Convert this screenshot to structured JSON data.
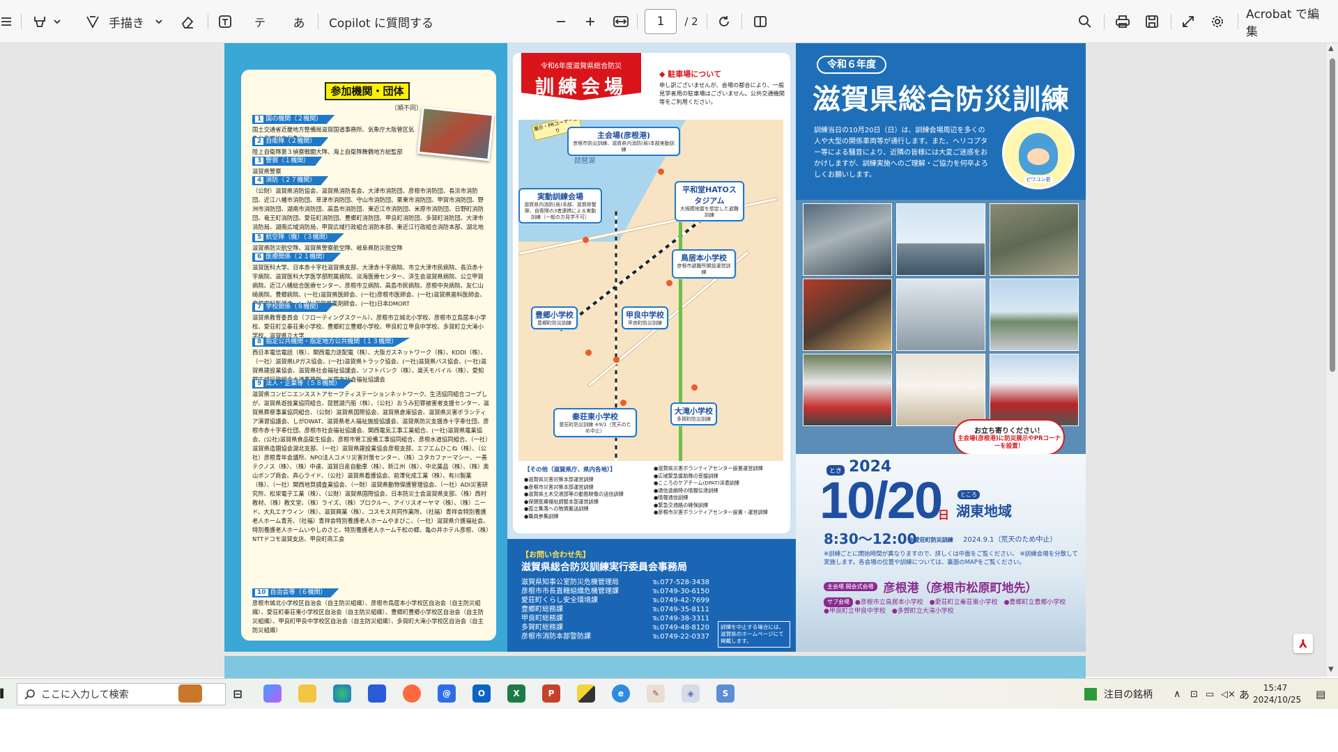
{
  "toolbar": {
    "handwrite_label": "手描き",
    "copilot_label": "Copilot に質問する",
    "current_page": "1",
    "page_total": "/ 2",
    "acrobat_label": "Acrobat で編集",
    "text_icon": "テ",
    "kana_icon": "あ"
  },
  "panel1": {
    "title": "参加機関・団体",
    "note": "（順不同）",
    "sections": [
      {
        "num": "1",
        "head": "国の機関",
        "count": "（２機関）",
        "text": "国土交通省近畿地方整備局滋賀国道事務所、気象庁大阪管区気象台彦根地方気象台"
      },
      {
        "num": "2",
        "head": "自衛隊",
        "count": "（２機関）",
        "text": "陸上自衛隊第３偵察戦闘大隊、海上自衛隊舞鶴地方総監部"
      },
      {
        "num": "3",
        "head": "警察",
        "count": "（１機関）",
        "text": "滋賀県警察"
      },
      {
        "num": "4",
        "head": "消防",
        "count": "（２７機関）",
        "text": "（公財）滋賀県消防協会、滋賀県消防長会、大津市消防団、彦根市消防団、長浜市消防団、近江八幡市消防団、草津市消防団、守山市消防団、栗東市消防団、甲賀市消防団、野洲市消防団、湖南市消防団、高島市消防団、東近江市消防団、米原市消防団、日野町消防団、竜王町消防団、愛荘町消防団、豊郷町消防団、甲良町消防団、多賀町消防団、大津市消防局、湖南広域消防局、甲賀広域行政組合消防本部、東近江行政組合消防本部、湖北地域消防本部、高島市消防本部"
      },
      {
        "num": "5",
        "head": "航空隊（機）",
        "count": "（３機関）",
        "text": "滋賀県防災航空隊、滋賀県警察航空隊、岐阜県防災航空隊"
      },
      {
        "num": "6",
        "head": "医療関係",
        "count": "（２１機関）",
        "text": "滋賀医科大学、日本赤十字社滋賀県支部、大津赤十字病院、市立大津市民病院、長浜赤十字病院、滋賀医科大学医学部附属病院、淡海医療センター、済生会滋賀県病院、公立甲賀病院、近江八幡総合医療センター、彦根市立病院、高島市民病院、彦根中央病院、友仁山崎病院、豊郷病院、(一社)滋賀県医師会、(一社)彦根市医師会、(一社)滋賀県歯科医師会、彦根歯科医師会、(一社)滋賀県薬剤師会、(一社)日本DMORT"
      },
      {
        "num": "7",
        "head": "学校関係",
        "count": "（８機関）",
        "text": "滋賀県教育委員会（フローティングスクール）、彦根市立城北小学校、彦根市立鳥居本小学校、愛荘町立秦荘東小学校、豊郷町立豊郷小学校、甲良町立甲良中学校、多賀町立大滝小学校、滋賀県立大学"
      },
      {
        "num": "8",
        "head": "指定公共機関・指定地方公共機関",
        "count": "（１３機関）",
        "text": "西日本電信電話（株）、関西電力送配電（株）、大阪ガスネットワーク（株）、KDDI（株）、（一社）滋賀県LPガス協会、(一社)滋賀県トラック協会、(一社)滋賀県バス協会、(一社)滋賀県建設業協会、滋賀県社会福祉協議会、ソフトバンク（株）、楽天モバイル（株）、愛知郡広域行政組合水道事務所、米原市社会福祉協議会"
      },
      {
        "num": "9",
        "head": "法人・企業等",
        "count": "（５８機関）",
        "text": "滋賀県コンビニエンスストアセーフティステーションネットワーク、生活協同組合コープしが、滋賀県遊技業協同組合、琵琶湖汽船（株）、（公社）おうみ犯罪被害者支援センター、滋賀県葬祭事業協同組合、（公財）滋賀県国際協会、滋賀県倉庫協会、滋賀県災害ボランティア演習協議会、しがDWAT、滋賀県老人福祉施設協議会、滋賀県防災支援赤十字奉仕団、彦根市赤十字奉仕団、彦根市社会福祉協議会、関西電気工事工業組合、(一社)滋賀県電業協会、(公社)滋賀県食品衛生協会、彦根市管工設備工事協同組合、彦根水道協同組合、（一社）滋賀県造園協会湖北支部、（一社）滋賀県建設業協会彦根支部、エフエムひこね（株）、（公社）彦根青年会議所、NPO法人コメリ災害対策センター、（株）ユタカファーマシー、一善テクノス（株）、（株）中達、滋賀日産自動車（株）、新江州（株）、中北薬品（株）、（株）奥山ボンプ商会、真心ライド、（公社）滋賀県看護協会、前澤化成工業（株）、有川製薬（株）、（一社）関西地質調査業協会、（一財）滋賀県動物保護管理協会、（一社）ADI災害研究所、松栄電子工業（株）、（公財）滋賀県国際協会、日本防災士会滋賀県支部、（株）西村教材、（株）教文堂、（株）ライズ、（株）プロクルー、アイリスオーヤマ（株）、（株）ニード、大丸エナウィン（株）、滋賀興業（株）、コスモス共同作業所、（社福）青祥会特別養護老人ホーム青芳、（社福）青祥会特別養護老人ホームやまびこ、（一社）滋賀県介護福祉会、特別養護老人ホームいやしのさと、特別養護老人ホーム千松の郷、亀の井ホテル彦根、（株）NTTドコモ滋賀支店、甲良町商工会"
      },
      {
        "num": "10",
        "head": "自治会等",
        "count": "（６機関）",
        "text": "彦根市城北小学校区自治会（自主防災組織）、彦根市鳥居本小学校区自治会（自主防災組織）、愛荘町秦荘東小学校区自治会（自主防災組織）、豊郷町豊郷小学校区自治会（自主防災組織）、甲良町甲良中学校区自治会（自主防災組織）、多賀町大滝小学校区自治会（自主防災組織）"
      }
    ]
  },
  "panel2": {
    "banner_small": "令和6年度滋賀県総合防災",
    "banner_large": "訓練会場",
    "parking_head": "◆ 駐車場について",
    "parking_text": "申し訳ございませんが、会場の都合により、一般見学者用の駐車場はございません。公共交通機関等をご利用ください。",
    "venues": [
      {
        "name": "主会場(彦根港)",
        "desc": "彦根市防災訓練、滋賀県内消防(局)本部実動訓練"
      },
      {
        "name": "実動訓練会場",
        "desc": "滋賀県内消防(局)本部、滋賀県警察、自衛隊の3者連携による実動訓練（一般の方見学不可）"
      },
      {
        "name": "平和堂HATOスタジアム",
        "desc": "大規模地震を想定した避難訓練"
      },
      {
        "name": "鳥居本小学校",
        "desc": "彦根市避難所開設運営訓練"
      },
      {
        "name": "豊郷小学校",
        "desc": "豊郷町防災訓練"
      },
      {
        "name": "甲良中学校",
        "desc": "甲良町防災訓練"
      },
      {
        "name": "秦荘東小学校",
        "desc": "愛荘町防災訓練 ※9/1（荒天のため中止）"
      },
      {
        "name": "大滝小学校",
        "desc": "多賀町防災訓練"
      }
    ],
    "map_badge": "展示・PRコーナーあり",
    "lake_label": "琵琶湖",
    "other_head": "【その他（滋賀県庁、県内各地）】",
    "other_left": [
      "●滋賀県災害対策本部運営訓練",
      "●彦根市災害対策本部運営訓練",
      "●滋賀県土木交通部等の動態映像の送信訓練",
      "●保健医療福祉調整本部運営訓練",
      "●孤立集落への物資搬送訓練",
      "●職員参集訓練"
    ],
    "other_right": [
      "●滋賀県災害ボランティアセンター設置運営訓練",
      "●広域緊急援助隊の受援訓練",
      "●こころのケアチーム(DPAT)派遣訓練",
      "●通信途絶時の情報伝達訓練",
      "●情報通信訓練",
      "●緊急交通路の確保訓練",
      "●彦根市災害ボランティアセンター設置・運営訓練"
    ],
    "contact_head": "【お問い合わせ先】",
    "contact_org": "滋賀県総合防災訓練実行委員会事務局",
    "contacts": [
      {
        "org": "滋賀県知事公室防災危機管理局",
        "tel": "℡077-528-3438"
      },
      {
        "org": "彦根市市長直轄組織危機管理課",
        "tel": "℡0749-30-6150"
      },
      {
        "org": "愛荘町くらし安全環境課",
        "tel": "℡0749-42-7699"
      },
      {
        "org": "豊郷町総務課",
        "tel": "℡0749-35-8111"
      },
      {
        "org": "甲良町総務課",
        "tel": "℡0749-38-3311"
      },
      {
        "org": "多賀町総務課",
        "tel": "℡0749-48-8120"
      },
      {
        "org": "彦根市消防本部警防課",
        "tel": "℡0749-22-0337"
      }
    ],
    "contact_note": "訓練を中止する場合には、滋賀県のホームページにて掲載します。"
  },
  "panel3": {
    "reiwa": "令和６年度",
    "title": "滋賀県総合防災訓練",
    "intro": "訓練当日の10月20日（日）は、訓練会場周辺を多くの人や大型の関係車両等が通行します。また、ヘリコプター等による騒音により、近隣の皆様には大変ご迷惑をおかけしますが、訓練実施へのご理解・ご協力を何卒よろしくお願いします。",
    "mascot_name": "ピワユン君",
    "bubble_a": "お立ち寄りください！",
    "bubble_b": "主会場(彦根港)に防災展示やPRコーナーを設置！",
    "toki": "とき",
    "year": "2024",
    "date": "10/20",
    "dow": "日",
    "tokoro": "ところ",
    "area": "湖東地域",
    "time": "8:30～12:00",
    "aisho_label": "※愛荘町防災訓練",
    "aisho_date": "2024.9.1（荒天のため中止）",
    "notes": "※訓練ごとに開始時間が異なりますので、詳しくは中面をご覧ください。 ※訓練会場を分散して実施します。各会場の位置や訓練については、裏面のMAPをご覧ください。",
    "main_tag": "主会場 開会式会場",
    "main_name": "彦根港（彦根市松原町地先）",
    "sub_tag": "サブ会場",
    "sub_venues": "●彦根市立鳥居本小学校　●愛荘町立秦荘東小学校　●豊郷町立豊郷小学校　●甲良町立甲良中学校　●多賀町立大滝小学校"
  },
  "taskbar": {
    "search_placeholder": "ここに入力して検索",
    "news_label": "注目の銘柄",
    "ime_label": "あ",
    "time": "15:47",
    "date": "2024/10/25"
  },
  "colors": {
    "accent_blue": "#1f6fb8",
    "accent_red": "#d9151b",
    "panel_cyan": "#3aa7d6"
  }
}
